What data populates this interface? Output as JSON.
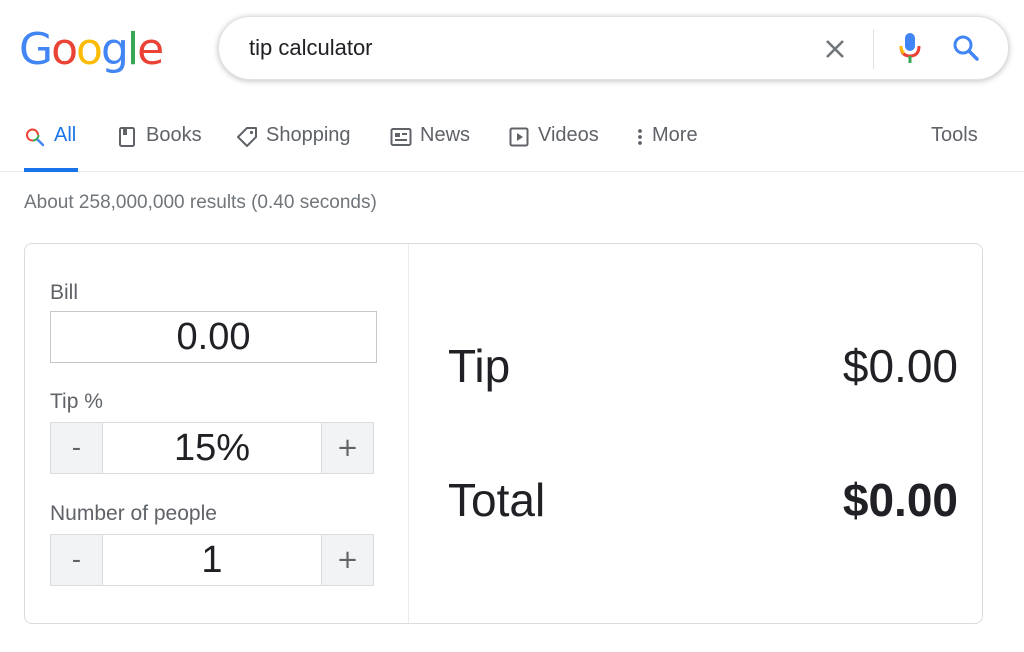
{
  "logo": {
    "letters": [
      "G",
      "o",
      "o",
      "g",
      "l",
      "e"
    ],
    "colors": [
      "#4285F4",
      "#EA4335",
      "#FBBC05",
      "#4285F4",
      "#34A853",
      "#EA4335"
    ]
  },
  "search": {
    "query": "tip calculator"
  },
  "tabs": [
    {
      "label": "All",
      "icon": "search-icon",
      "active": true
    },
    {
      "label": "Books",
      "icon": "book-icon",
      "active": false
    },
    {
      "label": "Shopping",
      "icon": "tag-icon",
      "active": false
    },
    {
      "label": "News",
      "icon": "newspaper-icon",
      "active": false
    },
    {
      "label": "Videos",
      "icon": "play-icon",
      "active": false
    },
    {
      "label": "More",
      "icon": "more-vert-icon",
      "active": false
    }
  ],
  "tools_label": "Tools",
  "result_stats": "About 258,000,000 results (0.40 seconds)",
  "calculator": {
    "bill_label": "Bill",
    "bill_value": "0.00",
    "tip_label": "Tip %",
    "tip_value": "15%",
    "people_label": "Number of people",
    "people_value": "1",
    "minus": "-",
    "plus": "+",
    "tip_output_label": "Tip",
    "tip_output_value": "$0.00",
    "total_output_label": "Total",
    "total_output_value": "$0.00"
  },
  "colors": {
    "accent": "#1a73e8",
    "text_secondary": "#5f6368",
    "mic_blue": "#4285F4",
    "mic_red": "#EA4335",
    "mic_yellow": "#FBBC05",
    "mic_green": "#34A853"
  }
}
